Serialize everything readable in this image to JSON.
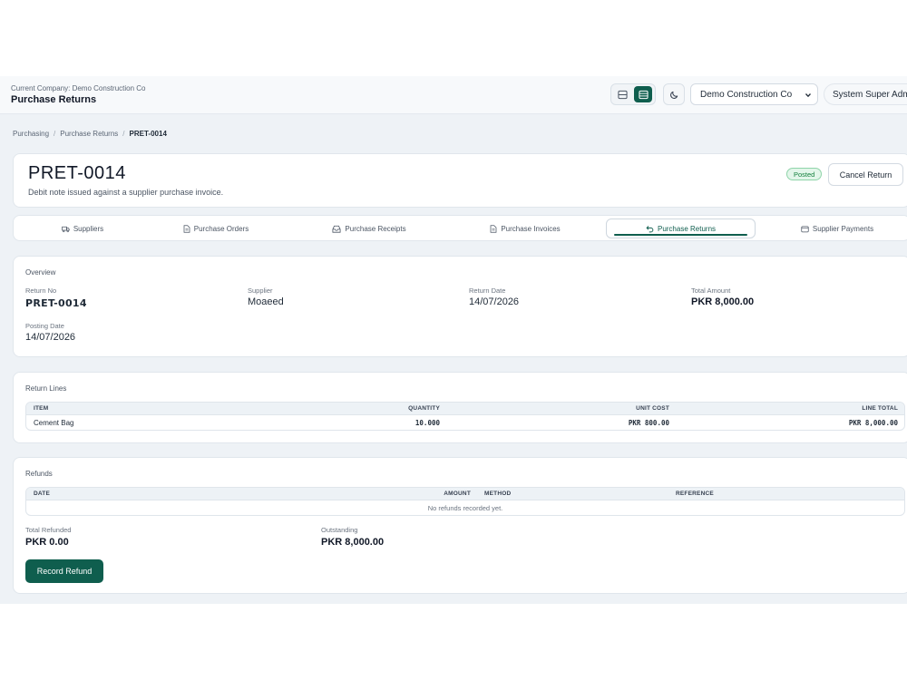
{
  "topbar": {
    "company_line": "Current Company: Demo Construction Co",
    "page_title": "Purchase Returns",
    "company_select_value": "Demo Construction Co",
    "user_label": "System Super Admin"
  },
  "breadcrumb": [
    "Purchasing",
    "Purchase Returns",
    "PRET-0014"
  ],
  "header": {
    "title": "PRET-0014",
    "subtitle": "Debit note issued against a supplier purchase invoice.",
    "status": "Posted",
    "cancel_label": "Cancel Return"
  },
  "tabs": [
    {
      "label": "Suppliers",
      "icon": "truck-icon"
    },
    {
      "label": "Purchase Orders",
      "icon": "document-icon"
    },
    {
      "label": "Purchase Receipts",
      "icon": "inbox-icon"
    },
    {
      "label": "Purchase Invoices",
      "icon": "document-icon"
    },
    {
      "label": "Purchase Returns",
      "icon": "undo-icon",
      "active": true
    },
    {
      "label": "Supplier Payments",
      "icon": "wallet-icon"
    }
  ],
  "overview": {
    "section_label": "Overview",
    "return_no_label": "Return No",
    "return_no": "PRET-0014",
    "supplier_label": "Supplier",
    "supplier": "Moaeed",
    "return_date_label": "Return Date",
    "return_date": "14/07/2026",
    "total_amount_label": "Total Amount",
    "total_amount": "PKR 8,000.00",
    "posting_date_label": "Posting Date",
    "posting_date": "14/07/2026"
  },
  "return_lines": {
    "section_label": "Return Lines",
    "columns": [
      "ITEM",
      "QUANTITY",
      "UNIT COST",
      "LINE TOTAL"
    ],
    "rows": [
      {
        "item": "Cement Bag",
        "quantity": "10.000",
        "unit_cost": "PKR 800.00",
        "line_total": "PKR 8,000.00"
      }
    ]
  },
  "refunds": {
    "section_label": "Refunds",
    "columns": [
      "DATE",
      "AMOUNT",
      "METHOD",
      "REFERENCE"
    ],
    "empty_text": "No refunds recorded yet.",
    "total_refunded_label": "Total Refunded",
    "total_refunded": "PKR 0.00",
    "outstanding_label": "Outstanding",
    "outstanding": "PKR 8,000.00",
    "record_label": "Record Refund"
  },
  "colors": {
    "accent": "#0f5e4e",
    "status_bg": "#e3f6ea",
    "status_text": "#14803d",
    "page_bg": "#eef2f6"
  }
}
